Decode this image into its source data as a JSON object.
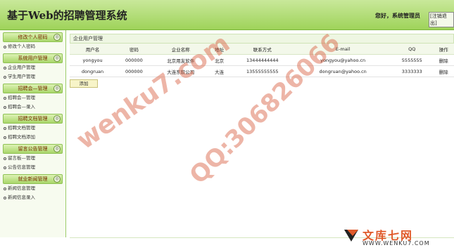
{
  "header": {
    "title": "基于Web的招聘管理系统",
    "greeting": "您好，系统管理员",
    "logout_label": "[注销退出]"
  },
  "sidebar": {
    "groups": [
      {
        "title": "修改个人密码",
        "items": [
          "修改个人密码"
        ]
      },
      {
        "title": "系统用户管理",
        "items": [
          "企业用户管理",
          "学生用户管理"
        ]
      },
      {
        "title": "招聘会—管理",
        "items": [
          "招聘会—管理",
          "招聘会—录入"
        ]
      },
      {
        "title": "招聘文档管理",
        "items": [
          "招聘文档管理",
          "招聘文档添加"
        ]
      },
      {
        "title": "留言公告管理",
        "items": [
          "留言板—管理",
          "公告信息管理"
        ]
      },
      {
        "title": "就业新闻管理",
        "items": [
          "新闻信息管理",
          "新闻信息录入"
        ]
      }
    ]
  },
  "main": {
    "panel_title": "企业用户管理",
    "columns": [
      "用户名",
      "密码",
      "企业名称",
      "地址",
      "联系方式",
      "E-mail",
      "QQ",
      "操作"
    ],
    "rows": [
      [
        "yongyou",
        "000000",
        "北京用友软件",
        "北京",
        "13444444444",
        "yongyou@yahoo.cn",
        "5555555",
        "删除"
      ],
      [
        "dongruan",
        "000000",
        "大连东软公司",
        "大连",
        "13555555555",
        "dongruan@yahoo.cn",
        "3333333",
        "删除"
      ]
    ],
    "add_label": "添加"
  },
  "watermarks": {
    "text1": "wenku7.com",
    "text2": "QQ:306826066"
  },
  "footer": {
    "logo_text": "文库七网",
    "logo_url": "WWW.WENKU7.COM"
  },
  "colors": {
    "header_green": "#9fd35a",
    "sidebar_bg": "#f7fbef",
    "watermark": "#d75a3c",
    "logo_orange": "#e05a2a"
  }
}
